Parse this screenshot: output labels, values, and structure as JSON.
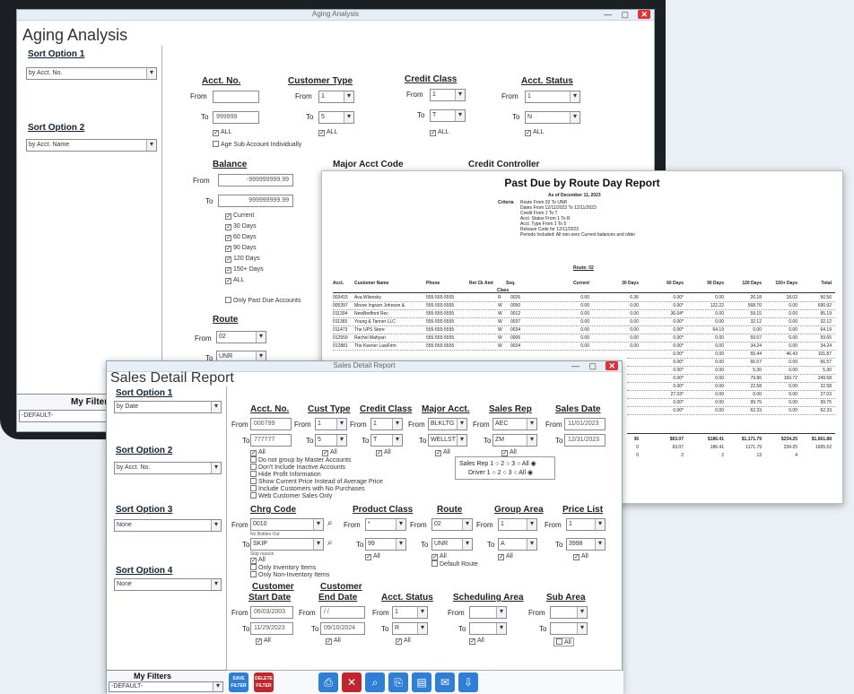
{
  "back_window": {
    "title": "Aging Analysis",
    "heading": "Aging Analysis",
    "sort1_label": "Sort Option 1",
    "sort1_value": "by Acct. No.",
    "sort2_label": "Sort Option 2",
    "sort2_value": "by Acct. Name",
    "my_filters_label": "My Filters",
    "my_filters_value": "-DEFAULT-",
    "acct_no": {
      "label": "Acct. No.",
      "from_label": "From",
      "to_label": "To",
      "to_value": "999999",
      "all": "ALL",
      "age_sub": "Age Sub Account Individually"
    },
    "customer_type": {
      "label": "Customer Type",
      "from_label": "From",
      "from_value": "1",
      "to_label": "To",
      "to_value": "5",
      "all": "ALL"
    },
    "credit_class": {
      "label": "Credit Class",
      "from_label": "From",
      "from_value": "1",
      "to_label": "To",
      "to_value": "T",
      "all": "ALL"
    },
    "acct_status": {
      "label": "Acct. Status",
      "from_label": "From",
      "from_value": "1",
      "to_label": "To",
      "to_value": "N",
      "all": "ALL"
    },
    "balance": {
      "label": "Balance",
      "from_label": "From",
      "from_value": "-999999999.99",
      "to_label": "To",
      "to_value": "999999999.99",
      "options": [
        "Current",
        "30 Days",
        "60 Days",
        "90 Days",
        "120 Days",
        "150+ Days",
        "ALL"
      ],
      "only_past_due": "Only Past Due Accounts"
    },
    "major_acct_code_label": "Major Acct Code",
    "credit_controller_label": "Credit Controller",
    "route": {
      "label": "Route",
      "from_label": "From",
      "from_value": "02",
      "to_label": "To",
      "to_value": "UNR"
    }
  },
  "report": {
    "title": "Past Due by Route Day Report",
    "as_of": "As of December 11, 2023",
    "criteria_label": "Criteria",
    "criteria": [
      "Route From 02   To UNR",
      "Dates From 12/11/2023 To 12/11/2023",
      "Credit From 1 To T",
      "Acct. Status From 1 To R",
      "Acct. Type From 1  To 5",
      "Release Code for 12/11/2023",
      "Periods Included:  All non-zero Current balances and older"
    ],
    "route_label": "Route: 02",
    "columns": [
      "Acct.",
      "Customer Name",
      "Phone",
      "Ret Ck Amt",
      "Seq.",
      "Current",
      "30 Days",
      "60 Days",
      "90 Days",
      "120 Days",
      "150+ Days",
      "Total"
    ],
    "class_label": "Class",
    "rows": [
      [
        "003415",
        "Ava Wilensky",
        "555-555-5555",
        "R",
        "0026",
        "0.00",
        "6.36",
        "0.00*",
        "0.00",
        "26.18",
        "18.02",
        "50.56"
      ],
      [
        "005397",
        "Moore Ingram Johnson &",
        "555-555-5555",
        "W",
        "0050",
        "0.00",
        "0.00",
        "0.00*",
        "122.22",
        "568.70",
        "0.00",
        "690.92"
      ],
      [
        "011304",
        "NewBedford Rec",
        "555-555-5555",
        "W",
        "0012",
        "0.00",
        "0.00",
        "36.04*",
        "0.00",
        "59.15",
        "0.00",
        "95.19"
      ],
      [
        "011365",
        "Young & Tanner LLC",
        "555-555-5555",
        "W",
        "0037",
        "0.00",
        "0.00",
        "0.00*",
        "0.00",
        "32.12",
        "0.00",
        "32.12"
      ],
      [
        "011473",
        "The UPS Store",
        "555-555-5555",
        "W",
        "0034",
        "0.00",
        "0.00",
        "0.00*",
        "64.19",
        "0.00",
        "0.00",
        "64.19"
      ],
      [
        "012559",
        "Rachel Mahyari",
        "555-555-5555",
        "W",
        "0006",
        "0.00",
        "0.00",
        "0.00*",
        "0.00",
        "59.57",
        "0.00",
        "59.65"
      ],
      [
        "012881",
        "The Keener LawFirm",
        "555-555-5555",
        "W",
        "0024",
        "0.00",
        "0.00",
        "0.00*",
        "0.00",
        "34.24",
        "0.00",
        "34.24"
      ]
    ],
    "partial_rows": [
      [
        "0.00*",
        "0.00",
        "55.44",
        "46.43",
        "101.87"
      ],
      [
        "0.00*",
        "0.00",
        "66.57",
        "0.00",
        "66.57"
      ],
      [
        "0.00*",
        "0.00",
        "5.30",
        "0.00",
        "5.30"
      ],
      [
        "0.00*",
        "0.00",
        "79.86",
        "169.72",
        "249.58"
      ],
      [
        "0.00*",
        "0.00",
        "22.58",
        "0.00",
        "22.58"
      ],
      [
        "27.03*",
        "0.00",
        "0.00",
        "0.00",
        "27.03"
      ],
      [
        "0.00*",
        "0.00",
        "99.75",
        "0.00",
        "99.75"
      ],
      [
        "0.00*",
        "0.00",
        "62.33",
        "0.00",
        "62.33"
      ]
    ],
    "totals": [
      "36",
      "$63.07",
      "$186.41",
      "$1,171.79",
      "$234.25",
      "$1,661.88"
    ],
    "totals2": [
      "0",
      "63.07",
      "186.41",
      "1171.79",
      "234.25",
      "1655.52"
    ],
    "totals3": [
      "0",
      "2",
      "2",
      "13",
      "4"
    ]
  },
  "front_window": {
    "title": "Sales Detail Report",
    "heading": "Sales Detail Report",
    "sort1_label": "Sort Option 1",
    "sort1_value": "by Date",
    "sort2_label": "Sort Option 2",
    "sort2_value": "by Acct. No.",
    "sort3_label": "Sort Option 3",
    "sort3_value": "None",
    "sort4_label": "Sort Option 4",
    "sort4_value": "None",
    "my_filters_label": "My Filters",
    "my_filters_value": "-DEFAULT-",
    "acct_no": {
      "label": "Acct. No.",
      "from_label": "From",
      "from_value": "000799",
      "to_label": "To",
      "to_value": "777777",
      "all": "All"
    },
    "cust_type": {
      "label": "Cust Type",
      "from_label": "From",
      "from_value": "1",
      "to_label": "To",
      "to_value": "5",
      "all": "All"
    },
    "credit_class": {
      "label": "Credit Class",
      "from_label": "From",
      "from_value": "1",
      "to_label": "To",
      "to_value": "T",
      "all": "All"
    },
    "major_acct": {
      "label": "Major Acct.",
      "from_label": "From",
      "from_value": "BLKLTG",
      "to_label": "To",
      "to_value": "WELLST",
      "all": "All"
    },
    "sales_rep": {
      "label": "Sales Rep",
      "from_label": "From",
      "from_value": "AEC",
      "to_label": "To",
      "to_value": "ZM",
      "all": "All"
    },
    "sales_date": {
      "label": "Sales Date",
      "from_label": "From",
      "from_value": "11/01/2023",
      "to_label": "To",
      "to_value": "12/31/2023"
    },
    "options": [
      "Do not group by Master Accounts",
      "Don't Include Inactive Accounts",
      "Hide Profit Information",
      "Show Current Price Instead of Average Price",
      "Include Customers with No Purchases",
      "Web Customer Sales Only"
    ],
    "sales_rep_radio": "Sales Rep 1 ○ 2 ○ 3 ○ All ◉",
    "driver_radio": "Driver 1 ○ 2 ○ 3 ○ All ◉",
    "chrg_code": {
      "label": "Chrg Code",
      "from_label": "From",
      "from_value": "0010",
      "from_note": "No Bottles Out",
      "to_label": "To",
      "to_value": "SKIP",
      "to_note": "Skip reason",
      "all": "All",
      "only_inv": "Only Inventory Items",
      "only_non_inv": "Only Non-Inventory Items"
    },
    "product_class": {
      "label": "Product Class",
      "from_label": "From",
      "from_value": "*",
      "to_label": "To",
      "to_value": "99",
      "all": "All"
    },
    "route": {
      "label": "Route",
      "from_label": "From",
      "from_value": "02",
      "to_label": "To",
      "to_value": "UNR",
      "all": "All",
      "default_route": "Default Route"
    },
    "group_area": {
      "label": "Group Area",
      "from_label": "From",
      "from_value": "1",
      "to_label": "To",
      "to_value": "A",
      "all": "All"
    },
    "price_list": {
      "label": "Price List",
      "from_label": "From",
      "from_value": "1",
      "to_label": "To",
      "to_value": "3998",
      "all": "All"
    },
    "cust_start": {
      "label1": "Customer",
      "label2": "Start Date",
      "from_label": "From",
      "from_value": "06/03/2003",
      "to_label": "To",
      "to_value": "11/29/2023",
      "all": "All"
    },
    "cust_end": {
      "label1": "Customer",
      "label2": "End Date",
      "from_label": "From",
      "from_value": "/ /",
      "to_label": "To",
      "to_value": "09/10/2024",
      "all": "All"
    },
    "acct_status": {
      "label": "Acct. Status",
      "from_label": "From",
      "from_value": "1",
      "to_label": "To",
      "to_value": "R",
      "all": "All"
    },
    "sched_area": {
      "label": "Scheduling Area",
      "from_label": "From",
      "to_label": "To",
      "all": "All"
    },
    "sub_area": {
      "label": "Sub Area",
      "from_label": "From",
      "to_label": "To",
      "all": "All"
    },
    "toolbar": {
      "save_filter": "SAVE FILTER",
      "delete_filter": "DELETE FILTER"
    }
  }
}
